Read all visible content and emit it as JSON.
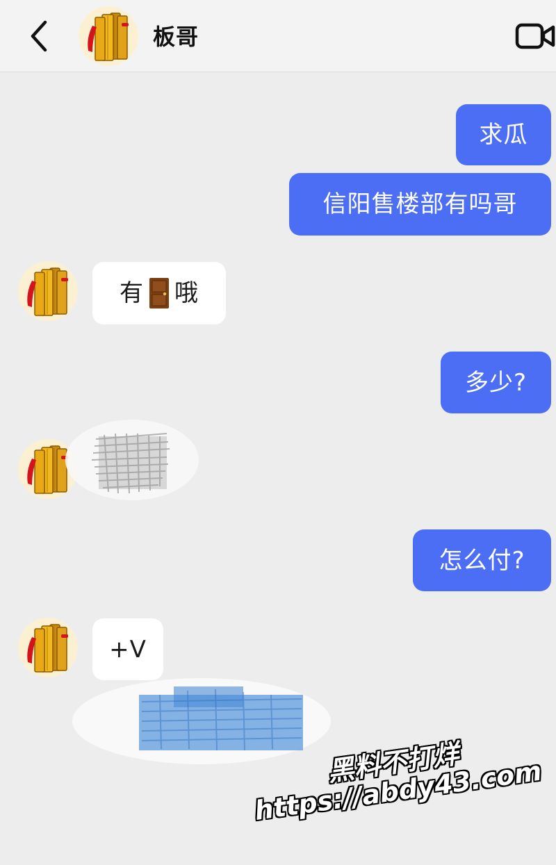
{
  "header": {
    "contact_name": "板哥",
    "back_icon": "chevron-left-icon",
    "video_icon": "video-camera-icon"
  },
  "colors": {
    "sent_bubble": "#4b6ef5",
    "received_bubble": "#ffffff",
    "background": "#ededed"
  },
  "messages": [
    {
      "sender": "me",
      "text": "求瓜"
    },
    {
      "sender": "me",
      "text": "信阳售楼部有吗哥"
    },
    {
      "sender": "contact",
      "text_before": "有",
      "emoji": "door-emoji",
      "text_after": "哦"
    },
    {
      "sender": "me",
      "text": "多少?"
    },
    {
      "sender": "contact",
      "redacted": true
    },
    {
      "sender": "me",
      "text": "怎么付?"
    },
    {
      "sender": "contact",
      "text": "+V"
    }
  ],
  "watermark": {
    "line1": "黑料不打烊",
    "line2": "https://abdy43.com"
  }
}
